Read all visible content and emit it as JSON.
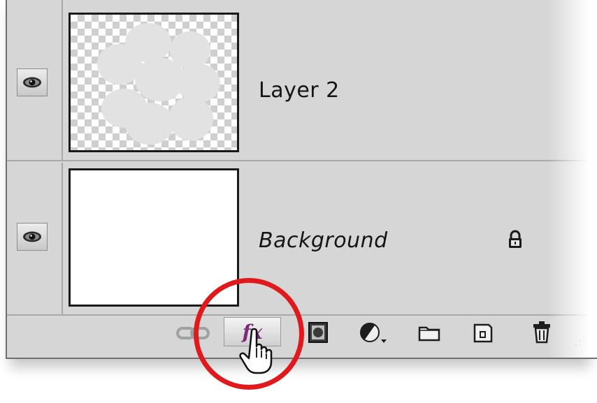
{
  "layers_panel": {
    "layers": [
      {
        "name": "Layer 2",
        "visible": true,
        "italic": false,
        "locked": false,
        "thumbnail": "transparent-with-gray-circles"
      },
      {
        "name": "Background",
        "visible": true,
        "italic": true,
        "locked": true,
        "thumbnail": "solid-white"
      }
    ],
    "toolbar": {
      "fx_label": "fx",
      "icons": [
        "link-layers-icon",
        "layer-styles-fx-icon",
        "layer-mask-icon",
        "adjustment-layer-icon",
        "new-group-icon",
        "new-layer-icon",
        "delete-layer-icon"
      ]
    }
  },
  "colors": {
    "panel_bg": "#d6d6d6",
    "divider": "#a9a9a9",
    "fx_text": "#7d2a7d",
    "highlight_ring": "#e1191c"
  }
}
